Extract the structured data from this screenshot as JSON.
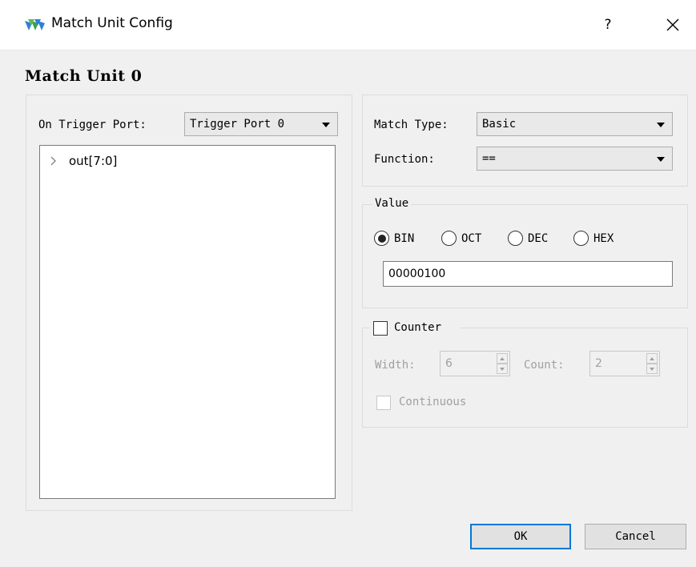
{
  "window": {
    "title": "Match Unit Config",
    "help_label": "?",
    "logo_color": "#2f7fd8"
  },
  "heading": "Match Unit 0",
  "trigger": {
    "label": "On Trigger Port:",
    "selected": "Trigger Port 0"
  },
  "tree": {
    "items": [
      {
        "label": "out[7:0]",
        "icon": "chevron-right-icon",
        "expanded": false
      }
    ]
  },
  "match": {
    "type_label": "Match Type:",
    "type_value": "Basic",
    "function_label": "Function:",
    "function_value": "=="
  },
  "value": {
    "legend": "Value",
    "radios": [
      {
        "label": "BIN",
        "selected": true
      },
      {
        "label": "OCT",
        "selected": false
      },
      {
        "label": "DEC",
        "selected": false
      },
      {
        "label": "HEX",
        "selected": false
      }
    ],
    "text": "00000100"
  },
  "counter": {
    "label": "Counter",
    "checked": false,
    "width_label": "Width:",
    "width_value": "6",
    "count_label": "Count:",
    "count_value": "2",
    "continuous_label": "Continuous",
    "continuous_checked": false
  },
  "buttons": {
    "ok": "OK",
    "cancel": "Cancel"
  },
  "colors": {
    "default_button_border": "#0078d7",
    "disabled_text": "#a0a0a0"
  }
}
